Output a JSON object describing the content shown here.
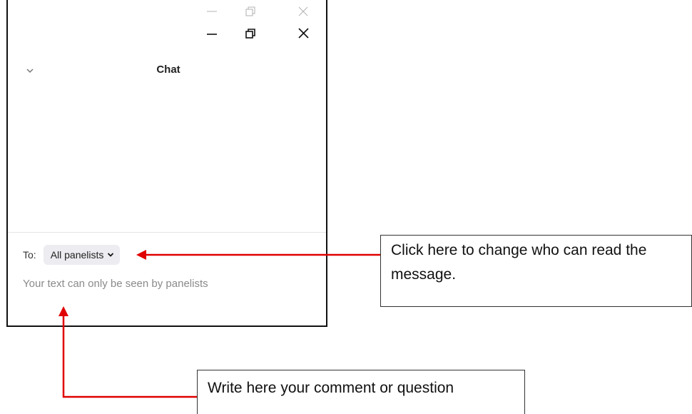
{
  "window": {
    "controls": {
      "minimize_icon": "minimize-icon",
      "restore_icon": "restore-icon",
      "close_icon": "close-icon"
    }
  },
  "chat": {
    "title": "Chat",
    "to_label": "To:",
    "recipient_selected": "All panelists",
    "input_placeholder": "Your text can only be seen by panelists"
  },
  "annotations": {
    "recipient_callout": "Click here to change who can read the message.",
    "input_callout": "Write here your comment or question",
    "arrow_color": "#e00000"
  }
}
